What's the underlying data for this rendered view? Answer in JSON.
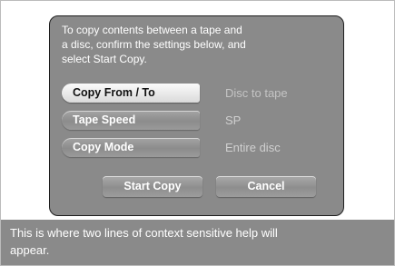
{
  "instructions": {
    "line1": "To copy contents between a tape and",
    "line2": "a disc, confirm the settings below, and",
    "line3": "select Start Copy."
  },
  "settings": [
    {
      "label": "Copy From / To",
      "value": "Disc to tape",
      "selected": true
    },
    {
      "label": "Tape Speed",
      "value": "SP",
      "selected": false
    },
    {
      "label": "Copy Mode",
      "value": "Entire disc",
      "selected": false
    }
  ],
  "actions": {
    "start_label": "Start Copy",
    "cancel_label": "Cancel"
  },
  "help": {
    "line1": "This is where two lines of context sensitive help will",
    "line2": "appear."
  },
  "colors": {
    "panel": "#8a8a8a",
    "selected_button": "#eeeeee",
    "text": "#ffffff"
  }
}
